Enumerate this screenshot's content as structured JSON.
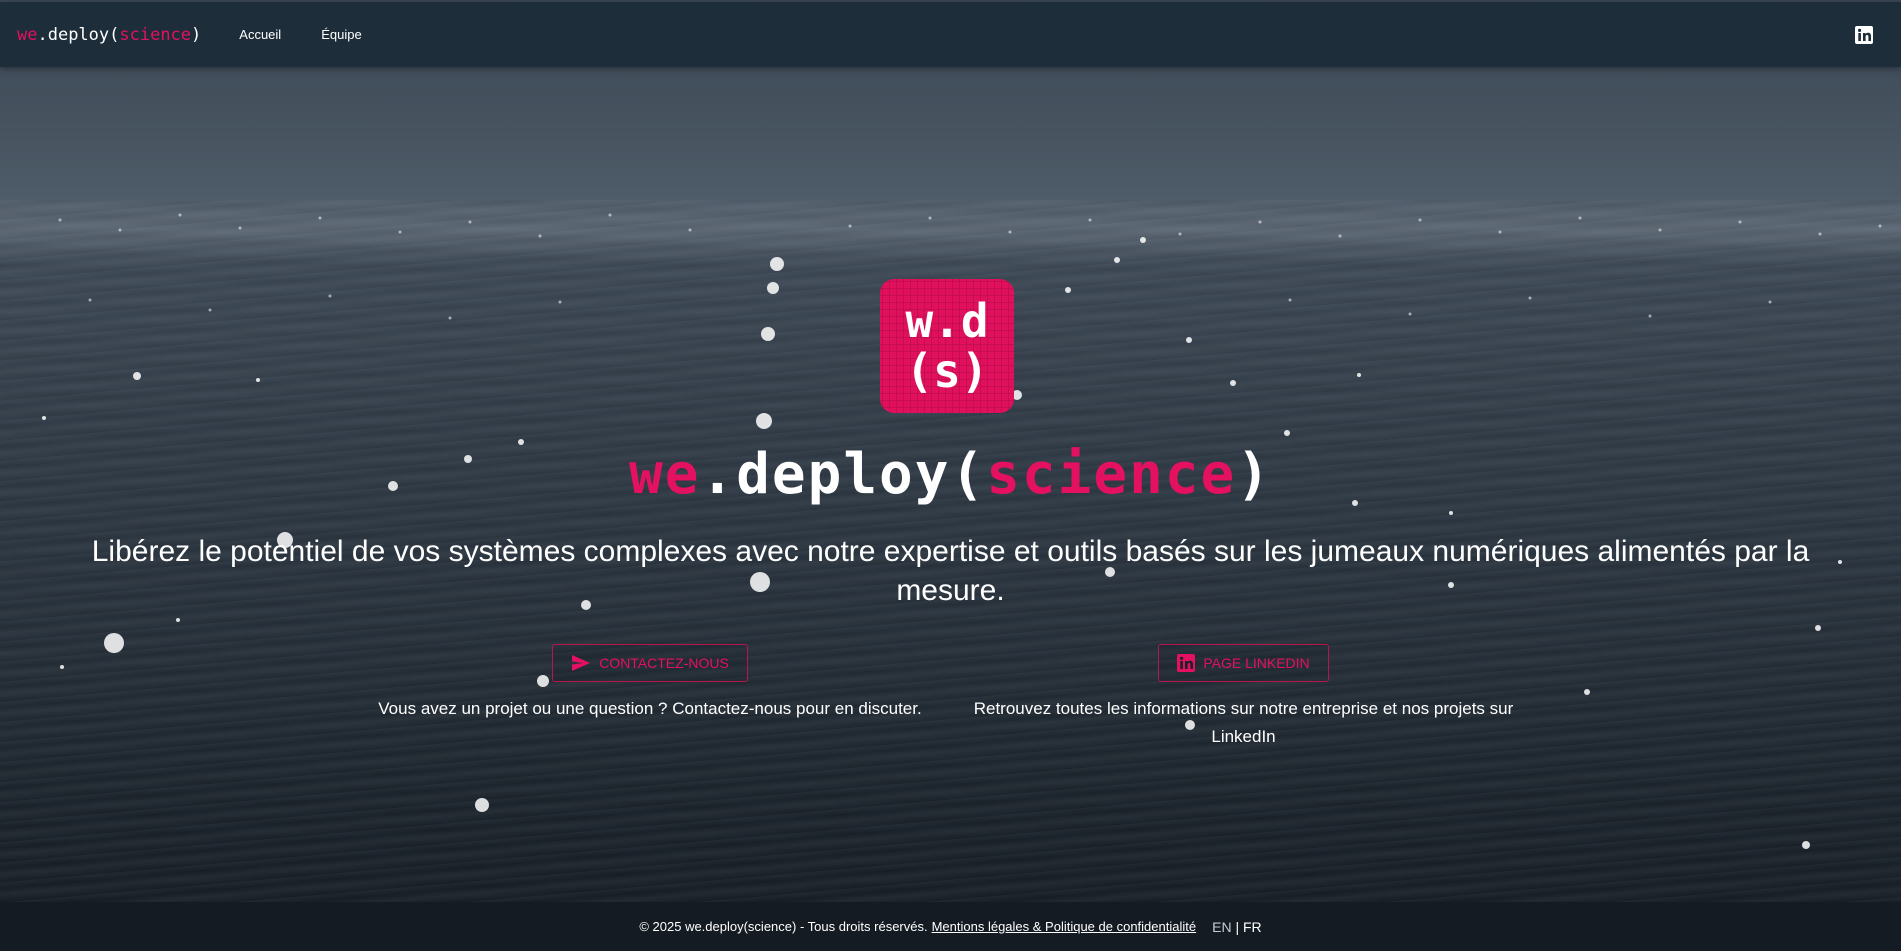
{
  "nav": {
    "brand": {
      "part1": "we",
      "part2": ".deploy(",
      "part3": "science",
      "part4": ")"
    },
    "links": [
      {
        "label": "Accueil"
      },
      {
        "label": "Équipe"
      }
    ],
    "linkedin_icon": "linkedin-icon"
  },
  "hero": {
    "logo": {
      "line1": "w.d",
      "line2": "(s)"
    },
    "title": {
      "part1": "we",
      "part2": ".deploy(",
      "part3": "science",
      "part4": ")"
    },
    "tagline": "Libérez le potentiel de vos systèmes complexes avec notre expertise et outils basés sur les jumeaux numériques alimentés par la mesure.",
    "contact": {
      "button_label": "CONTACTEZ-NOUS",
      "icon": "send-icon",
      "description": "Vous avez un projet ou une question ? Contactez-nous pour en discuter."
    },
    "linkedin": {
      "button_label": "PAGE LINKEDIN",
      "icon": "linkedin-icon",
      "description": "Retrouvez toutes les informations sur notre entreprise et nos projets sur LinkedIn"
    }
  },
  "footer": {
    "copyright": "© 2025 we.deploy(science) - Tous droits réservés.",
    "legal_link": "Mentions légales & Politique de confidentialité",
    "lang_en": "EN",
    "lang_sep": "|",
    "lang_fr": "FR"
  },
  "colors": {
    "accent": "#e3115f",
    "navbar": "#1e2d3a",
    "footer": "#141b23"
  }
}
